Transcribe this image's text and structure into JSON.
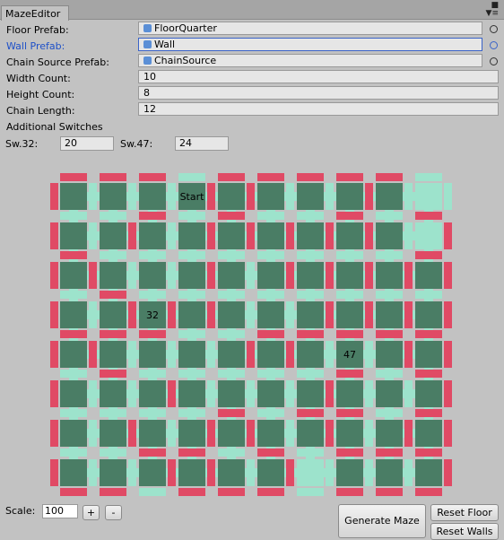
{
  "window": {
    "tab_title": "MazeEditor"
  },
  "fields": {
    "floor_prefab": {
      "label": "Floor Prefab:",
      "value": "FloorQuarter"
    },
    "wall_prefab": {
      "label": "Wall Prefab:",
      "value": "Wall"
    },
    "chain_source_prefab": {
      "label": "Chain Source Prefab:",
      "value": "ChainSource"
    },
    "width_count": {
      "label": "Width Count:",
      "value": "10"
    },
    "height_count": {
      "label": "Height Count:",
      "value": "8"
    },
    "chain_length": {
      "label": "Chain Length:",
      "value": "12"
    }
  },
  "switches": {
    "header": "Additional Switches",
    "sw32": {
      "label": "Sw.32:",
      "value": "20"
    },
    "sw47": {
      "label": "Sw.47:",
      "value": "24"
    }
  },
  "maze": {
    "cols": 10,
    "rows": 8,
    "colors": {
      "floor": "#4a7d65",
      "wall_on": "#e04a65",
      "wall_off": "#9de3cc",
      "background": "#c2c2c2"
    },
    "cell_labels": [
      {
        "row": 0,
        "col": 3,
        "text": "Start"
      },
      {
        "row": 3,
        "col": 2,
        "text": "32"
      },
      {
        "row": 4,
        "col": 7,
        "text": "47"
      }
    ],
    "highlighted_cells": [
      {
        "row": 0,
        "col": 9
      },
      {
        "row": 1,
        "col": 9
      },
      {
        "row": 7,
        "col": 6
      }
    ],
    "h_walls": [
      [
        1,
        1,
        1,
        0,
        1,
        1,
        1,
        1,
        1,
        0
      ],
      [
        0,
        0,
        1,
        0,
        1,
        0,
        0,
        1,
        0,
        1
      ],
      [
        1,
        0,
        0,
        0,
        0,
        0,
        0,
        0,
        0,
        1
      ],
      [
        0,
        1,
        0,
        0,
        0,
        0,
        0,
        0,
        0,
        0
      ],
      [
        1,
        1,
        1,
        0,
        0,
        1,
        1,
        1,
        1,
        1
      ],
      [
        0,
        1,
        0,
        0,
        0,
        0,
        0,
        1,
        0,
        1
      ],
      [
        0,
        0,
        0,
        0,
        1,
        0,
        1,
        1,
        0,
        1
      ],
      [
        0,
        0,
        1,
        1,
        0,
        1,
        0,
        1,
        1,
        1
      ],
      [
        1,
        1,
        0,
        1,
        1,
        1,
        0,
        1,
        1,
        1
      ]
    ],
    "v_walls": [
      [
        1,
        0,
        0,
        0,
        1,
        1,
        0,
        0,
        1,
        0,
        0
      ],
      [
        1,
        0,
        1,
        0,
        1,
        1,
        1,
        1,
        1,
        0,
        1
      ],
      [
        1,
        1,
        0,
        0,
        1,
        0,
        1,
        1,
        1,
        1,
        1
      ],
      [
        1,
        0,
        1,
        1,
        1,
        0,
        0,
        1,
        1,
        1,
        1
      ],
      [
        1,
        1,
        0,
        0,
        0,
        1,
        1,
        0,
        0,
        1,
        1
      ],
      [
        1,
        0,
        0,
        1,
        0,
        0,
        0,
        1,
        0,
        0,
        1
      ],
      [
        1,
        0,
        1,
        0,
        1,
        1,
        0,
        1,
        0,
        1,
        1
      ],
      [
        1,
        0,
        0,
        1,
        1,
        0,
        1,
        0,
        0,
        0,
        1
      ]
    ]
  },
  "footer": {
    "scale_label": "Scale:",
    "scale_value": "100",
    "plus_label": "+",
    "minus_label": "-",
    "generate_label": "Generate Maze",
    "reset_floor_label": "Reset Floor",
    "reset_walls_label": "Reset Walls"
  }
}
